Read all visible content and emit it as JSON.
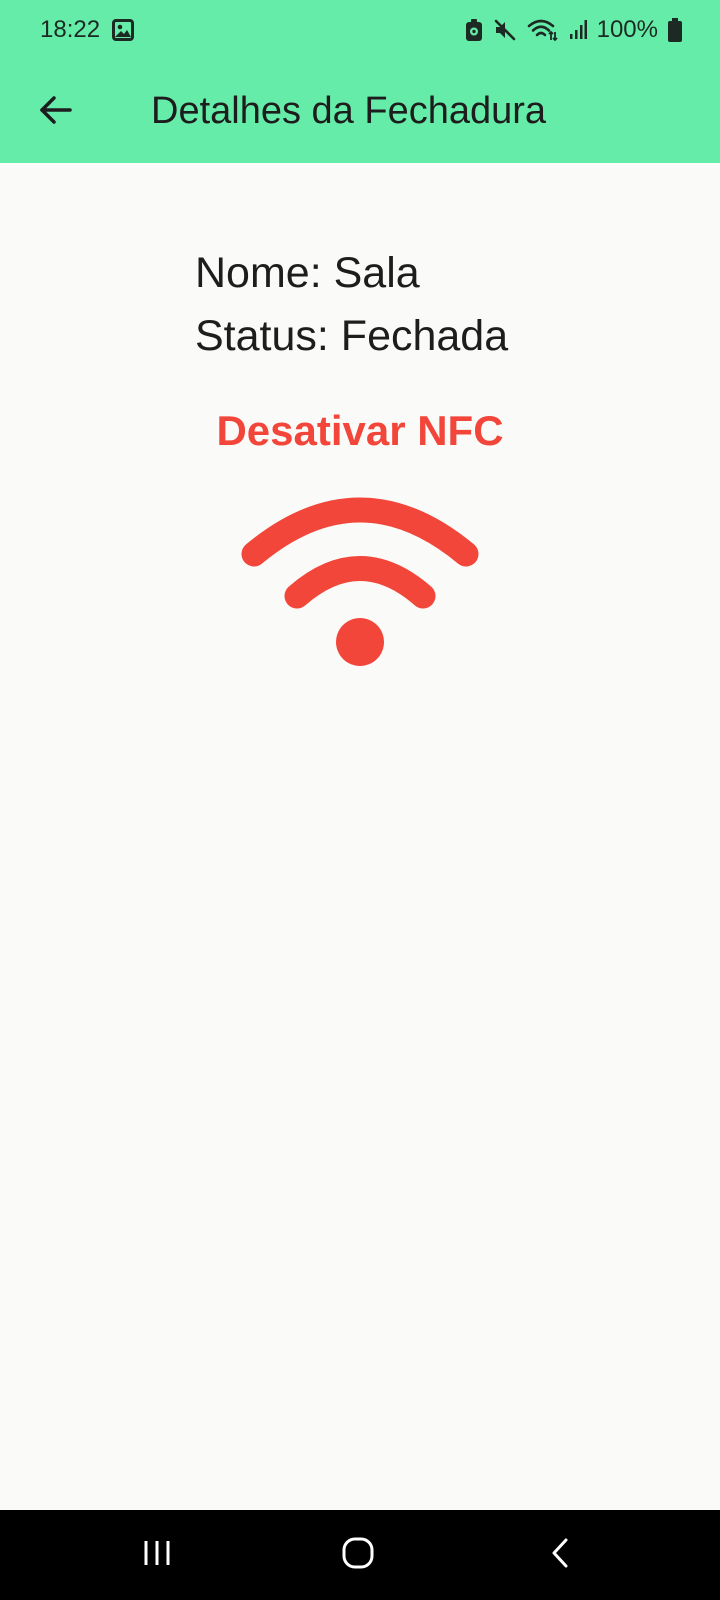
{
  "status_bar": {
    "time": "18:22",
    "battery": "100%",
    "icons": [
      "image-icon",
      "lock-notification-icon",
      "mute-icon",
      "wifi-icon",
      "signal-icon",
      "battery-icon"
    ]
  },
  "app_bar": {
    "title": "Detalhes da Fechadura",
    "back_icon": "arrow-back-icon",
    "color": "#66eca9"
  },
  "lock": {
    "name_line": "Nome: Sala",
    "status_line": "Status: Fechada"
  },
  "nfc": {
    "label": "Desativar NFC",
    "icon": "wifi-icon",
    "color": "#f2463a"
  },
  "nav_bar": {
    "buttons": [
      "recent-apps-icon",
      "home-icon",
      "back-icon"
    ]
  }
}
